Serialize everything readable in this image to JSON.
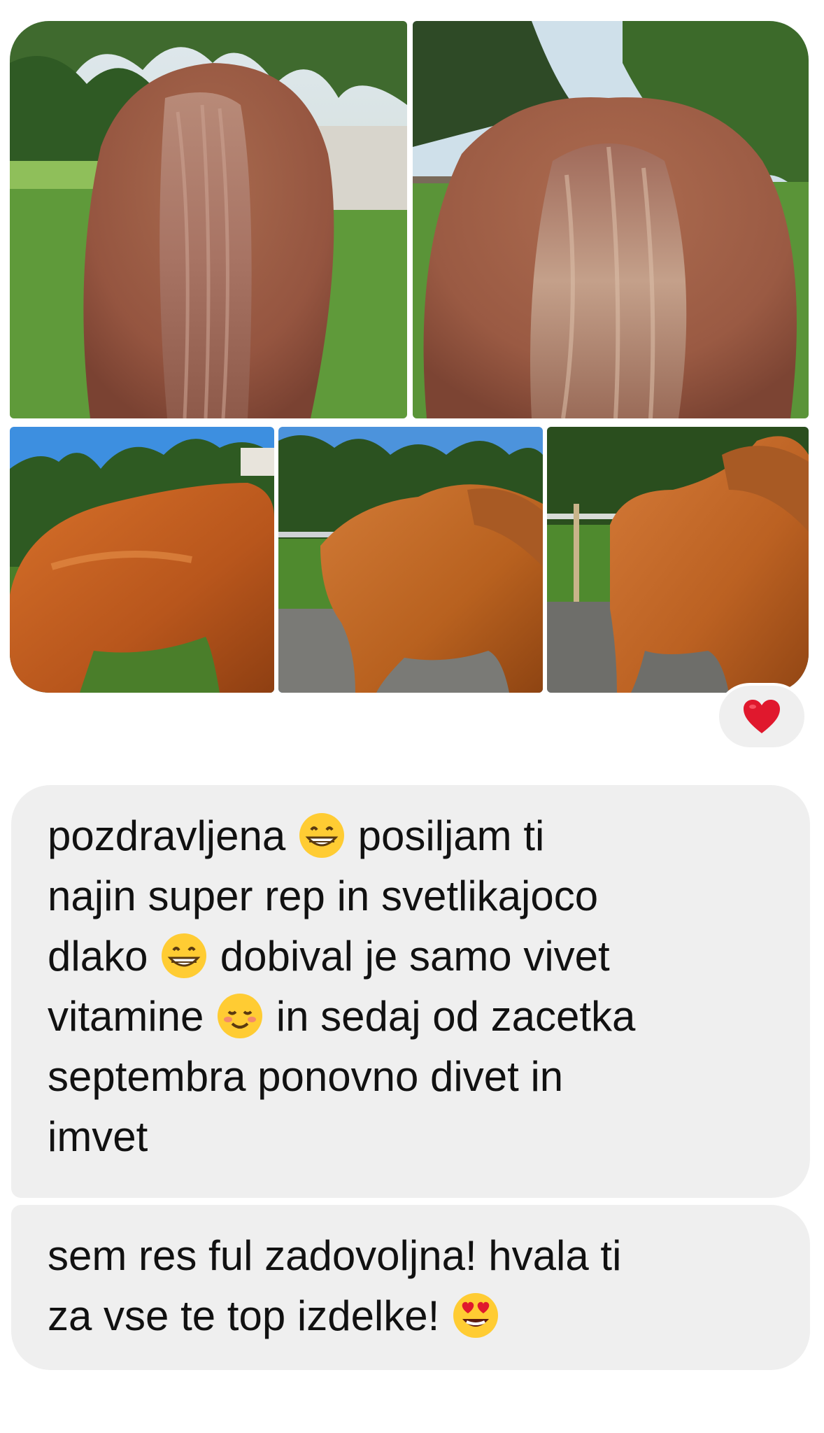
{
  "reaction": {
    "icon": "red-heart-icon",
    "color": "#e0182d"
  },
  "photos": [
    {
      "subject": "horse tail from behind",
      "icon": "photo-horse-tail-1"
    },
    {
      "subject": "horse tail from behind",
      "icon": "photo-horse-tail-2"
    },
    {
      "subject": "horse side view",
      "icon": "photo-horse-side-1"
    },
    {
      "subject": "horse side view",
      "icon": "photo-horse-side-2"
    },
    {
      "subject": "horse side view",
      "icon": "photo-horse-side-3"
    }
  ],
  "messages": [
    {
      "lines": [
        {
          "pre": "pozdravljena ",
          "emoji": "grinning-face-icon",
          "post": " posiljam ti"
        },
        {
          "pre": "najin super rep in svetlikajoco",
          "emoji": "",
          "post": ""
        },
        {
          "pre": "dlako ",
          "emoji": "grinning-face-icon",
          "post": " dobival je samo vivet"
        },
        {
          "pre": "vitamine ",
          "emoji": "smiling-face-icon",
          "post": " in sedaj od zacetka"
        },
        {
          "pre": "septembra ponovno divet in",
          "emoji": "",
          "post": ""
        },
        {
          "pre": "imvet",
          "emoji": "",
          "post": ""
        }
      ]
    },
    {
      "lines": [
        {
          "pre": "sem res ful zadovoljna! hvala ti",
          "emoji": "",
          "post": ""
        },
        {
          "pre": "za vse te top izdelke! ",
          "emoji": "heart-eyes-face-icon",
          "post": ""
        }
      ]
    }
  ]
}
